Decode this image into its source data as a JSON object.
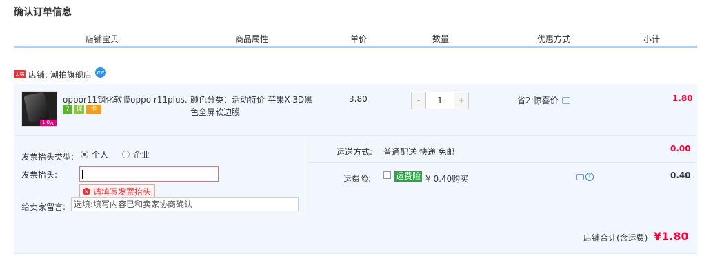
{
  "page_title": "确认订单信息",
  "columns": [
    "店铺宝贝",
    "商品属性",
    "单价",
    "数量",
    "优惠方式",
    "小计"
  ],
  "shop": {
    "badge": "天猫",
    "label": "店铺: 潮拍旗舰店",
    "ww_text": "ww"
  },
  "item": {
    "title": "oppor11钢化软膜oppo r11plus...",
    "thumb_price_tag": "1.8元",
    "badges": [
      "7",
      "保",
      "卡"
    ],
    "attribute": "颜色分类：活动特价-苹果X-3D黑色全屏软边膜",
    "unit_price": "3.80",
    "quantity": "1",
    "minus": "-",
    "plus": "+",
    "promo": "省2:惊喜价",
    "subtotal": "1.80"
  },
  "invoice": {
    "type_label": "发票抬头类型:",
    "option_personal": "个人",
    "option_company": "企业",
    "head_label": "发票抬头:",
    "head_value": "",
    "error": "请填写发票抬头",
    "error_icon": "×"
  },
  "message": {
    "label": "给卖家留言:",
    "placeholder": "选填:填写内容已和卖家协商确认"
  },
  "shipping": {
    "label": "运送方式:",
    "value": "普通配送 快递 免邮",
    "fee": "0.00"
  },
  "insurance": {
    "label": "运费险:",
    "tag": "运费险",
    "price_text": "¥ 0.40购买",
    "fee": "0.40",
    "help": "?"
  },
  "total": {
    "label": "店铺合计(含运费)",
    "value": "¥1.80"
  }
}
